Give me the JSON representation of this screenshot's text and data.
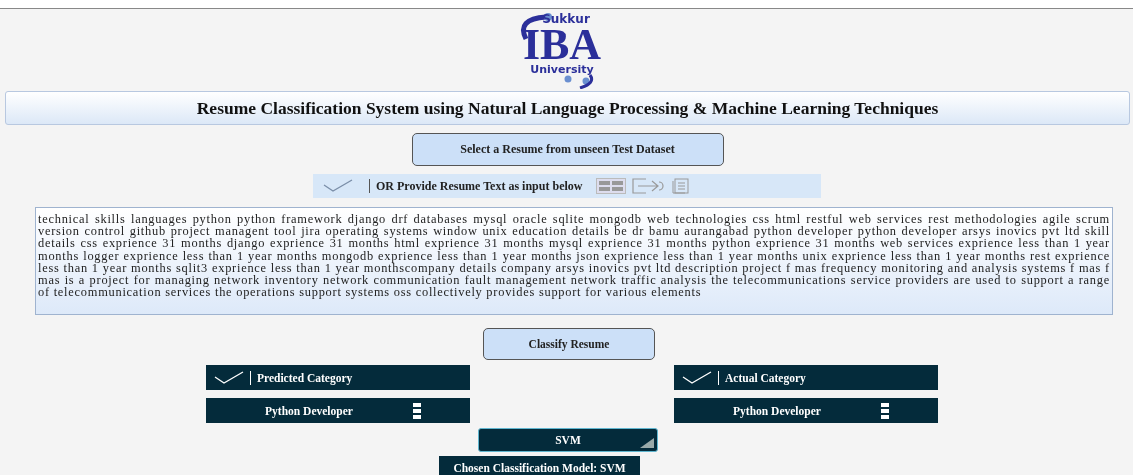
{
  "logo": {
    "top": "Sukkur",
    "main": "IBA",
    "bottom": "University"
  },
  "title": "Resume Classification System using Natural Language Processing & Machine Learning Techniques",
  "select_button": "Select a Resume from unseen Test Dataset",
  "input_toggle": {
    "checked": false,
    "label": "OR Provide Resume Text as input below"
  },
  "resume_text": "technical skills languages python python framework django drf databases mysql oracle sqlite mongodb web technologies css html restful web services rest methodologies agile scrum version control github project managent tool jira operating systems window unix education details be dr bamu aurangabad python developer python developer arsys inovics pvt ltd skill details css exprience 31 months django exprience 31 months html exprience 31 months mysql exprience 31 months python exprience 31 months web services exprience less than 1 year months logger exprience less than 1 year months mongodb exprience less than 1 year months json exprience less than 1 year months unix exprience less than 1 year months rest exprience less than 1 year months sqlit3 exprience less than 1 year monthscompany details company arsys inovics pvt ltd description project f mas frequency monitoring and analysis systems f mas f mas is a project for managing network inventory network communication fault management network traffic analysis the telecommunications service providers are used to support a range of telecommunication services the operations support systems oss collectively provides support for various elements",
  "classify_button": "Classify Resume",
  "results": [
    {
      "label": "Predicted Category",
      "checked": false,
      "value": "Python Developer"
    },
    {
      "label": "Actual Category",
      "checked": false,
      "value": "Python Developer"
    }
  ],
  "model_dropdown": "SVM",
  "chosen_model": "Chosen Classification Model: SVM"
}
